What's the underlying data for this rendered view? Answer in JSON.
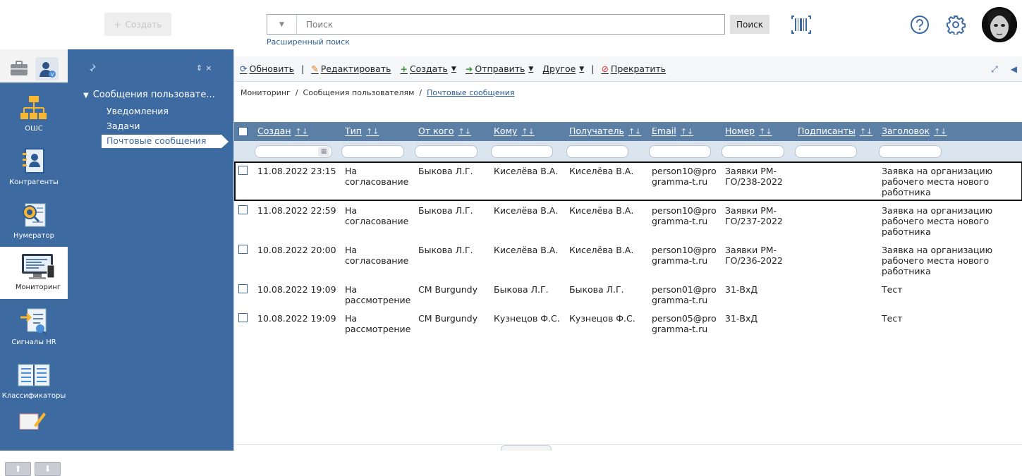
{
  "header": {
    "create_label": "Создать",
    "search_placeholder": "Поиск",
    "search_button": "Поиск",
    "advanced_search": "Расширенный поиск"
  },
  "rail": {
    "items": [
      {
        "label": "ОШС",
        "icon": "org-chart-icon"
      },
      {
        "label": "Контрагенты",
        "icon": "address-book-icon"
      },
      {
        "label": "Нумератор",
        "icon": "numerator-icon"
      },
      {
        "label": "Мониторинг",
        "icon": "monitor-icon"
      },
      {
        "label": "Сигналы HR",
        "icon": "hr-signals-icon"
      },
      {
        "label": "Классификаторы",
        "icon": "classifier-icon"
      }
    ]
  },
  "tree": {
    "root": "Сообщения пользовате...",
    "children": [
      "Уведомления",
      "Задачи",
      "Почтовые сообщения"
    ],
    "selected_index": 2
  },
  "toolbar": {
    "refresh": "Обновить",
    "edit": "Редактировать",
    "create": "Создать",
    "send": "Отправить",
    "other": "Другое",
    "stop": "Прекратить"
  },
  "breadcrumb": [
    "Мониторинг",
    "Сообщения пользователям",
    "Почтовые сообщения"
  ],
  "grid": {
    "columns": [
      "Создан",
      "Тип",
      "От кого",
      "Кому",
      "Получатель",
      "Email",
      "Номер",
      "Подписанты",
      "Заголовок"
    ],
    "rows": [
      {
        "created": "11.08.2022 23:15",
        "type": [
          "На",
          "согласование"
        ],
        "from": "Быкова Л.Г.",
        "to": "Киселёва В.А.",
        "recipient": "Киселёва В.А.",
        "email": [
          "person10@pro",
          "gramma-t.ru"
        ],
        "number": [
          "Заявки РМ-",
          "ГО/238-2022"
        ],
        "signers": "",
        "title": [
          "Заявка на организацию",
          "рабочего места нового",
          "работника"
        ]
      },
      {
        "created": "11.08.2022 22:59",
        "type": [
          "На",
          "согласование"
        ],
        "from": "Быкова Л.Г.",
        "to": "Киселёва В.А.",
        "recipient": "Киселёва В.А.",
        "email": [
          "person10@pro",
          "gramma-t.ru"
        ],
        "number": [
          "Заявки РМ-",
          "ГО/237-2022"
        ],
        "signers": "",
        "title": [
          "Заявка на организацию",
          "рабочего места нового",
          "работника"
        ]
      },
      {
        "created": "10.08.2022 20:00",
        "type": [
          "На",
          "согласование"
        ],
        "from": "Быкова Л.Г.",
        "to": "Киселёва В.А.",
        "recipient": "Киселёва В.А.",
        "email": [
          "person10@pro",
          "gramma-t.ru"
        ],
        "number": [
          "Заявки РМ-",
          "ГО/236-2022"
        ],
        "signers": "",
        "title": [
          "Заявка на организацию",
          "рабочего места нового",
          "работника"
        ]
      },
      {
        "created": "10.08.2022 19:09",
        "type": [
          "На",
          "рассмотрение"
        ],
        "from": "CM Burgundy",
        "to": "Быкова Л.Г.",
        "recipient": "Быкова Л.Г.",
        "email": [
          "person01@pro",
          "gramma-t.ru"
        ],
        "number": [
          "31-ВхД"
        ],
        "signers": "",
        "title": [
          "Тест"
        ]
      },
      {
        "created": "10.08.2022 19:09",
        "type": [
          "На",
          "рассмотрение"
        ],
        "from": "CM Burgundy",
        "to": "Кузнецов Ф.С.",
        "recipient": "Кузнецов Ф.С.",
        "email": [
          "person05@pro",
          "gramma-t.ru"
        ],
        "number": [
          "31-ВхД"
        ],
        "signers": "",
        "title": [
          "Тест"
        ]
      }
    ],
    "selected_row": 0
  },
  "colors": {
    "sidebar": "#3d6aa0",
    "grid_header": "#5c7fa5",
    "filter_row": "#dbe5f0",
    "link": "#2b5c97"
  }
}
